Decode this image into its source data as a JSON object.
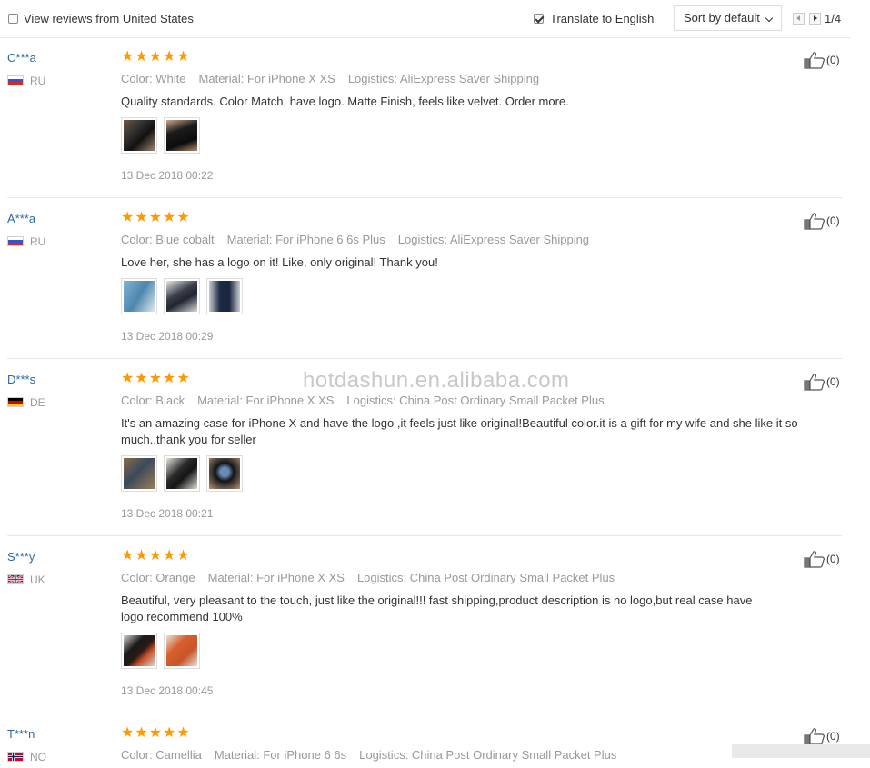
{
  "toolbar": {
    "view_reviews_label": "View reviews from United States",
    "translate_label": "Translate to English",
    "translate_checked": true,
    "sort_label": "Sort by default",
    "page_indicator": "1/4"
  },
  "watermark": "hotdashun.en.alibaba.com",
  "reviews": [
    {
      "user": "C***a",
      "country": "RU",
      "flag": "russia",
      "stars": "★★★★★",
      "color": "Color: White",
      "material": "Material: For iPhone X XS",
      "logistics": "Logistics: AliExpress Saver Shipping",
      "text": "Quality standards. Color Match, have logo. Matte Finish, feels like velvet. Order more.",
      "date": "13 Dec 2018 00:22",
      "likes": "(0)"
    },
    {
      "user": "A***a",
      "country": "RU",
      "flag": "russia",
      "stars": "★★★★★",
      "color": "Color: Blue cobalt",
      "material": "Material: For iPhone 6 6s Plus",
      "logistics": "Logistics: AliExpress Saver Shipping",
      "text": "Love her, she has a logo on it! Like, only original! Thank you!",
      "date": "13 Dec 2018 00:29",
      "likes": "(0)"
    },
    {
      "user": "D***s",
      "country": "DE",
      "flag": "germany",
      "stars": "★★★★★",
      "color": "Color: Black",
      "material": "Material: For iPhone X XS",
      "logistics": "Logistics: China Post Ordinary Small Packet Plus",
      "text": "It's an amazing case for iPhone X and have the logo ,it feels just like original!Beautiful color.it is a gift for my wife and she like it so much..thank you for seller",
      "date": "13 Dec 2018 00:21",
      "likes": "(0)"
    },
    {
      "user": "S***y",
      "country": "UK",
      "flag": "uk",
      "stars": "★★★★★",
      "color": "Color: Orange",
      "material": "Material: For iPhone X XS",
      "logistics": "Logistics: China Post Ordinary Small Packet Plus",
      "text": "Beautiful, very pleasant to the touch, just like the original!!! fast shipping,product description is no logo,but real case have logo.recommend 100%",
      "date": "13 Dec 2018 00:45",
      "likes": "(0)"
    },
    {
      "user": "T***n",
      "country": "NO",
      "flag": "norway",
      "stars": "★★★★★",
      "color": "Color: Camellia",
      "material": "Material: For iPhone 6 6s",
      "logistics": "Logistics: China Post Ordinary Small Packet Plus",
      "text": "",
      "date": "",
      "likes": "(0)"
    }
  ]
}
